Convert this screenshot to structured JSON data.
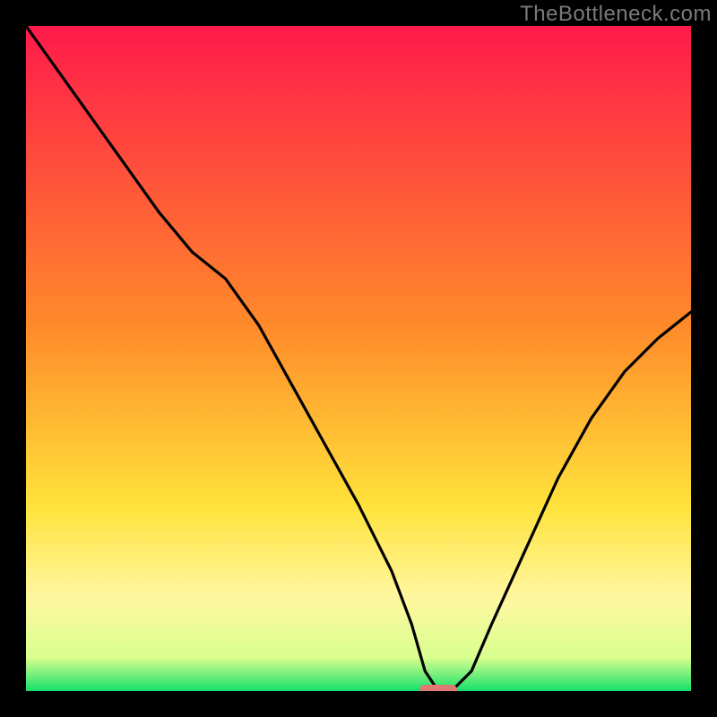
{
  "watermark": "TheBottleneck.com",
  "colors": {
    "frame": "#000000",
    "curve": "#000000",
    "marker_fill": "#e17a74",
    "marker_stroke": "#d96a64",
    "grad_top": "#ff1a4b",
    "grad_mid1": "#ff8a2a",
    "grad_mid2": "#ffe23a",
    "grad_band_top": "#fff7a0",
    "grad_band_bot": "#d9ff8f",
    "grad_bottom": "#15e06a"
  },
  "chart_data": {
    "type": "line",
    "title": "",
    "xlabel": "",
    "ylabel": "",
    "xlim": [
      0,
      100
    ],
    "ylim": [
      0,
      100
    ],
    "grid": false,
    "legend": false,
    "marker": {
      "x": 62,
      "y": 0,
      "shape": "pill"
    },
    "series": [
      {
        "name": "bottleneck-curve",
        "x": [
          0,
          5,
          10,
          15,
          20,
          25,
          30,
          35,
          40,
          45,
          50,
          55,
          58,
          60,
          62,
          64,
          67,
          70,
          75,
          80,
          85,
          90,
          95,
          100
        ],
        "y": [
          100,
          93,
          86,
          79,
          72,
          66,
          62,
          55,
          46,
          37,
          28,
          18,
          10,
          3,
          0,
          0,
          3,
          10,
          21,
          32,
          41,
          48,
          53,
          57
        ]
      }
    ]
  }
}
